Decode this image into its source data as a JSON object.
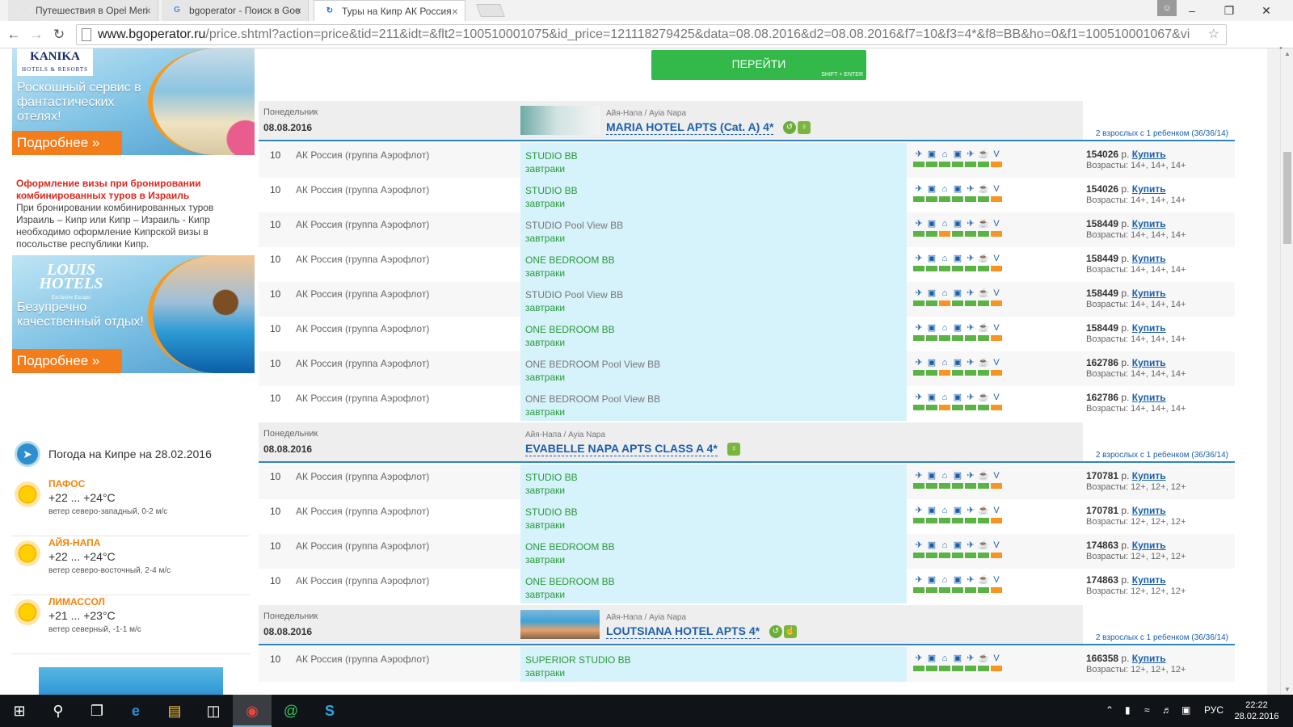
{
  "browser": {
    "tabs": [
      {
        "title": "Путешествия в Opel Meri",
        "favicon": "travel-favicon",
        "fav_glyph": "□",
        "fav_color": "#d9d9d9",
        "active": false
      },
      {
        "title": "bgoperator - Поиск в Goo",
        "favicon": "google-favicon",
        "fav_glyph": "G",
        "fav_color": "#4285f4",
        "active": false
      },
      {
        "title": "Туры на Кипр АК Россия",
        "favicon": "loading-favicon",
        "fav_glyph": "↻",
        "fav_color": "#1b6bd0",
        "active": true
      }
    ],
    "url_host": "www.bgoperator.ru",
    "url_path": "/price.shtml?action=price&tid=211&idt=&flt2=100510001075&id_price=121118279425&data=08.08.2016&d2=08.08.2016&f7=10&f3=4*&f8=BB&ho=0&f1=100510001067&vi"
  },
  "sidebar": {
    "banner1": {
      "logo": "KANIKA",
      "logo_sub": "HOTELS & RESORTS",
      "slogan": "Роскошный сервис в фантастических отелях!",
      "more": "Подробнее"
    },
    "visa_note": {
      "title": "Оформление визы при бронировании комбинированных туров в Израиль",
      "text": "При бронировании комбинированных туров Израиль – Кипр или Кипр – Израиль - Кипр необходимо оформление Кипрской визы в посольстве республики Кипр."
    },
    "banner2": {
      "logo": "LOUIS HOTELS",
      "logo_sub": "Exclusive Escape",
      "slogan": "Безупречно качественный отдых!",
      "more": "Подробнее"
    },
    "weather": {
      "title": "Погода на Кипре на 28.02.2016",
      "cities": [
        {
          "name": "ПАФОС",
          "temp": "+22 ... +24°C",
          "wind": "ветер северо-западный, 0-2 м/с"
        },
        {
          "name": "АЙЯ-НАПА",
          "temp": "+22 ... +24°C",
          "wind": "ветер северо-восточный, 2-4 м/с"
        },
        {
          "name": "ЛИМАССОЛ",
          "temp": "+21 ... +23°C",
          "wind": "ветер северный, -1-1 м/с"
        }
      ]
    }
  },
  "main": {
    "go_button": "ПЕРЕЙТИ",
    "go_hint": "SHIFT + ENTER",
    "service_icons": [
      "plane-icon",
      "bus-icon",
      "hotel-icon",
      "bus-icon",
      "plane-icon",
      "cocktail-icon",
      "visa-icon"
    ],
    "service_glyphs": [
      "✈",
      "▣",
      "⌂",
      "▣",
      "✈",
      "☕",
      "V"
    ],
    "status_colors": {
      "ok": "#5bb346",
      "warn": "#f79422"
    },
    "hotels": [
      {
        "day": "Понедельник",
        "date": "08.08.2016",
        "region": "Айя-Напа / Ayia Napa",
        "name": "MARIA HOTEL APTS (Cat. A) 4*",
        "has_photo": true,
        "icons": [
          "eco-icon",
          "family-icon"
        ],
        "icon_glyphs": [
          "↺",
          "♀"
        ],
        "guests": "2 взрослых с 1 ребенком (36/36/14)",
        "offers": [
          {
            "nights": "10",
            "airline": "АК Россия (группа Аэрофлот)",
            "room": "STUDIO BB",
            "meal": "завтраки",
            "highlight": true,
            "price": "154026",
            "currency": "р.",
            "buy": "Купить",
            "ages": "Возрасты: 14+, 14+, 14+",
            "status": [
              0,
              0,
              0,
              0,
              0,
              0,
              1
            ]
          },
          {
            "nights": "10",
            "airline": "АК Россия (группа Аэрофлот)",
            "room": "STUDIO BB",
            "meal": "завтраки",
            "highlight": true,
            "price": "154026",
            "currency": "р.",
            "buy": "Купить",
            "ages": "Возрасты: 14+, 14+, 14+",
            "status": [
              0,
              0,
              0,
              0,
              0,
              0,
              1
            ]
          },
          {
            "nights": "10",
            "airline": "АК Россия (группа Аэрофлот)",
            "room": "STUDIO Pool View BB",
            "meal": "завтраки",
            "highlight": false,
            "price": "158449",
            "currency": "р.",
            "buy": "Купить",
            "ages": "Возрасты: 14+, 14+, 14+",
            "status": [
              0,
              0,
              1,
              0,
              0,
              0,
              1
            ]
          },
          {
            "nights": "10",
            "airline": "АК Россия (группа Аэрофлот)",
            "room": "ONE BEDROOM BB",
            "meal": "завтраки",
            "highlight": true,
            "price": "158449",
            "currency": "р.",
            "buy": "Купить",
            "ages": "Возрасты: 14+, 14+, 14+",
            "status": [
              0,
              0,
              0,
              0,
              0,
              0,
              1
            ]
          },
          {
            "nights": "10",
            "airline": "АК Россия (группа Аэрофлот)",
            "room": "STUDIO Pool View BB",
            "meal": "завтраки",
            "highlight": false,
            "price": "158449",
            "currency": "р.",
            "buy": "Купить",
            "ages": "Возрасты: 14+, 14+, 14+",
            "status": [
              0,
              0,
              1,
              0,
              0,
              0,
              1
            ]
          },
          {
            "nights": "10",
            "airline": "АК Россия (группа Аэрофлот)",
            "room": "ONE BEDROOM BB",
            "meal": "завтраки",
            "highlight": true,
            "price": "158449",
            "currency": "р.",
            "buy": "Купить",
            "ages": "Возрасты: 14+, 14+, 14+",
            "status": [
              0,
              0,
              0,
              0,
              0,
              0,
              1
            ]
          },
          {
            "nights": "10",
            "airline": "АК Россия (группа Аэрофлот)",
            "room": "ONE BEDROOM Pool View BB",
            "meal": "завтраки",
            "highlight": false,
            "price": "162786",
            "currency": "р.",
            "buy": "Купить",
            "ages": "Возрасты: 14+, 14+, 14+",
            "status": [
              0,
              0,
              1,
              0,
              0,
              0,
              1
            ]
          },
          {
            "nights": "10",
            "airline": "АК Россия (группа Аэрофлот)",
            "room": "ONE BEDROOM Pool View BB",
            "meal": "завтраки",
            "highlight": false,
            "price": "162786",
            "currency": "р.",
            "buy": "Купить",
            "ages": "Возрасты: 14+, 14+, 14+",
            "status": [
              0,
              0,
              1,
              0,
              0,
              0,
              1
            ]
          }
        ]
      },
      {
        "day": "Понедельник",
        "date": "08.08.2016",
        "region": "Айя-Напа / Ayia Napa",
        "name": "EVABELLE NAPA APTS CLASS A 4*",
        "has_photo": false,
        "icons": [
          "family-icon"
        ],
        "icon_glyphs": [
          "♀"
        ],
        "guests": "2 взрослых с 1 ребенком (36/36/14)",
        "offers": [
          {
            "nights": "10",
            "airline": "АК Россия (группа Аэрофлот)",
            "room": "STUDIO BB",
            "meal": "завтраки",
            "highlight": true,
            "price": "170781",
            "currency": "р.",
            "buy": "Купить",
            "ages": "Возрасты: 12+, 12+, 12+",
            "status": [
              0,
              0,
              0,
              0,
              0,
              0,
              1
            ]
          },
          {
            "nights": "10",
            "airline": "АК Россия (группа Аэрофлот)",
            "room": "STUDIO BB",
            "meal": "завтраки",
            "highlight": true,
            "price": "170781",
            "currency": "р.",
            "buy": "Купить",
            "ages": "Возрасты: 12+, 12+, 12+",
            "status": [
              0,
              0,
              0,
              0,
              0,
              0,
              1
            ]
          },
          {
            "nights": "10",
            "airline": "АК Россия (группа Аэрофлот)",
            "room": "ONE BEDROOM BB",
            "meal": "завтраки",
            "highlight": true,
            "price": "174863",
            "currency": "р.",
            "buy": "Купить",
            "ages": "Возрасты: 12+, 12+, 12+",
            "status": [
              0,
              0,
              0,
              0,
              0,
              0,
              1
            ]
          },
          {
            "nights": "10",
            "airline": "АК Россия (группа Аэрофлот)",
            "room": "ONE BEDROOM BB",
            "meal": "завтраки",
            "highlight": true,
            "price": "174863",
            "currency": "р.",
            "buy": "Купить",
            "ages": "Возрасты: 12+, 12+, 12+",
            "status": [
              0,
              0,
              0,
              0,
              0,
              0,
              1
            ]
          }
        ]
      },
      {
        "day": "Понедельник",
        "date": "08.08.2016",
        "region": "Айя-Напа / Ayia Napa",
        "name": "LOUTSIANA HOTEL APTS 4*",
        "has_photo": true,
        "icons": [
          "eco-icon",
          "thumbs-up-icon"
        ],
        "icon_glyphs": [
          "↺",
          "☝"
        ],
        "guests": "2 взрослых с 1 ребенком (36/36/14)",
        "offers": [
          {
            "nights": "10",
            "airline": "АК Россия (группа Аэрофлот)",
            "room": "SUPERIOR STUDIO BB",
            "meal": "завтраки",
            "highlight": true,
            "price": "166358",
            "currency": "р.",
            "buy": "Купить",
            "ages": "Возрасты: 12+, 12+, 12+",
            "status": [
              0,
              0,
              0,
              0,
              0,
              0,
              1
            ]
          }
        ]
      }
    ]
  },
  "taskbar": {
    "language": "РУС",
    "time": "22:22",
    "date": "28.02.2016"
  }
}
